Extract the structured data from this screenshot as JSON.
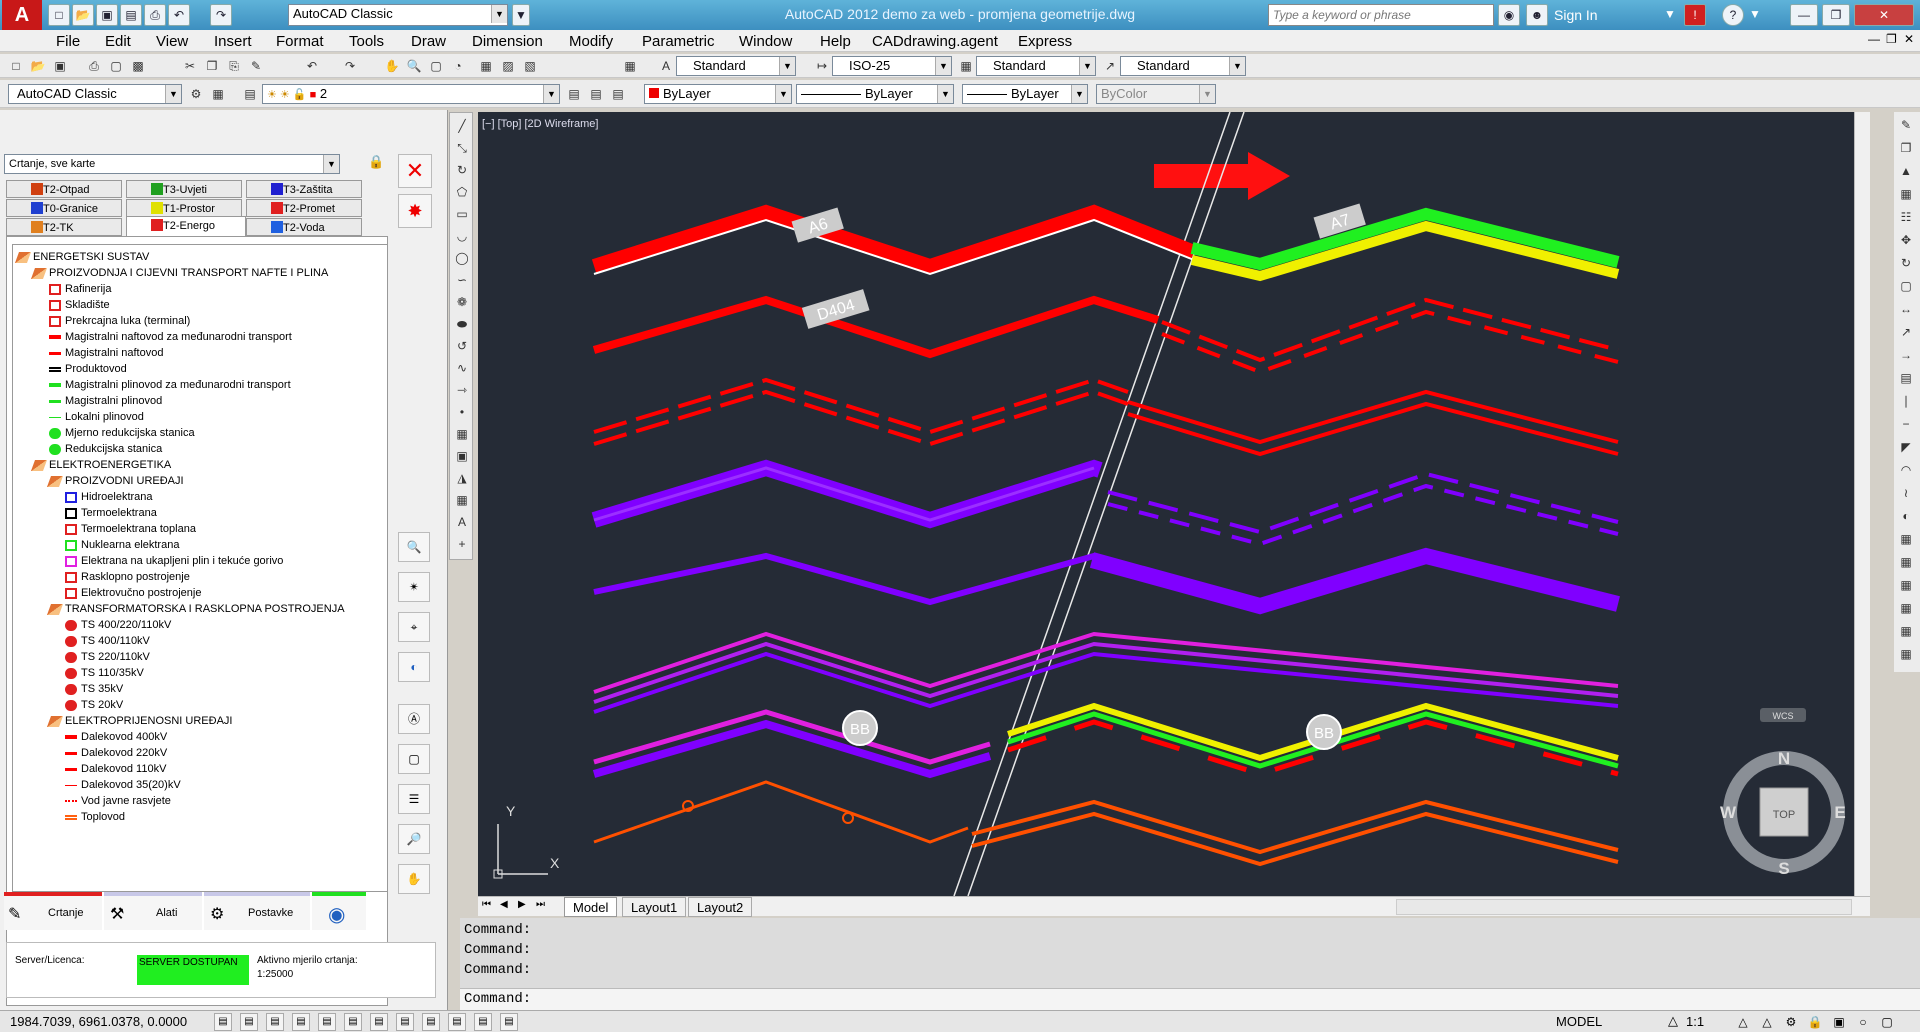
{
  "window": {
    "title": "AutoCAD 2012    demo za web - promjena geometrije.dwg",
    "search_placeholder": "Type a keyword or phrase",
    "sign_in": "Sign In"
  },
  "quick_access": {
    "workspace": "AutoCAD Classic"
  },
  "menu": [
    "File",
    "Edit",
    "View",
    "Insert",
    "Format",
    "Tools",
    "Draw",
    "Dimension",
    "Modify",
    "Parametric",
    "Window",
    "Help",
    "CADdrawing.agent",
    "Express"
  ],
  "toolbar2": {
    "text_style": "Standard",
    "dim_style": "ISO-25",
    "table_style": "Standard",
    "mleader_style": "Standard"
  },
  "toolbar3": {
    "workspace": "AutoCAD Classic",
    "layer": "2",
    "color": "ByLayer",
    "linetype": "ByLayer",
    "lineweight": "ByLayer",
    "plotstyle": "ByColor"
  },
  "panel": {
    "dropdown": "Crtanje, sve karte",
    "tabs": [
      {
        "label": "T2-Otpad",
        "color": "#d04010"
      },
      {
        "label": "T3-Uvjeti",
        "color": "#20a020"
      },
      {
        "label": "T3-Zaštita",
        "color": "#2020d0"
      },
      {
        "label": "T0-Granice",
        "color": "#2040d0"
      },
      {
        "label": "T1-Prostor",
        "color": "#e0e000"
      },
      {
        "label": "T2-Promet",
        "color": "#e02020"
      },
      {
        "label": "T2-TK",
        "color": "#e08020"
      },
      {
        "label": "T2-Energo",
        "color": "#e02020"
      },
      {
        "label": "T2-Voda",
        "color": "#2060e0"
      }
    ],
    "tree": [
      {
        "label": "ENERGETSKI SUSTAV",
        "level": 0,
        "icon": "folder",
        "color": "#e07030"
      },
      {
        "label": "PROIZVODNJA I CIJEVNI TRANSPORT NAFTE I PLINA",
        "level": 1,
        "icon": "folder",
        "color": "#e07030"
      },
      {
        "label": "Rafinerija",
        "level": 2,
        "icon": "box",
        "color": "#e02020"
      },
      {
        "label": "Skladište",
        "level": 2,
        "icon": "box",
        "color": "#e02020"
      },
      {
        "label": "Prekrcajna luka (terminal)",
        "level": 2,
        "icon": "box",
        "color": "#e02020"
      },
      {
        "label": "Magistralni naftovod za međunarodni transport",
        "level": 2,
        "icon": "thick",
        "color": "#ff0000"
      },
      {
        "label": "Magistralni naftovod",
        "level": 2,
        "icon": "line",
        "color": "#ff0000"
      },
      {
        "label": "Produktovod",
        "level": 2,
        "icon": "dbl",
        "color": "#000000"
      },
      {
        "label": "Magistralni plinovod za međunarodni transport",
        "level": 2,
        "icon": "thick",
        "color": "#20e020"
      },
      {
        "label": "Magistralni plinovod",
        "level": 2,
        "icon": "line",
        "color": "#20e020"
      },
      {
        "label": "Lokalni plinovod",
        "level": 2,
        "icon": "thin",
        "color": "#20e020"
      },
      {
        "label": "Mjerno redukcijska stanica",
        "level": 2,
        "icon": "circle",
        "color": "#20e020"
      },
      {
        "label": "Redukcijska stanica",
        "level": 2,
        "icon": "circle",
        "color": "#20e020"
      },
      {
        "label": "ELEKTROENERGETIKA",
        "level": 1,
        "icon": "folder",
        "color": "#e07030"
      },
      {
        "label": "PROIZVODNI UREĐAJI",
        "level": 2,
        "icon": "folder",
        "color": "#e07030"
      },
      {
        "label": "Hidroelektrana",
        "level": 3,
        "icon": "box",
        "color": "#2020e0"
      },
      {
        "label": "Termoelektrana",
        "level": 3,
        "icon": "box",
        "color": "#000000"
      },
      {
        "label": "Termoelektrana toplana",
        "level": 3,
        "icon": "box",
        "color": "#e02020"
      },
      {
        "label": "Nuklearna elektrana",
        "level": 3,
        "icon": "box",
        "color": "#20e020"
      },
      {
        "label": "Elektrana na ukapljeni plin i tekuće gorivo",
        "level": 3,
        "icon": "box",
        "color": "#e020e0"
      },
      {
        "label": "Rasklopno postrojenje",
        "level": 3,
        "icon": "box",
        "color": "#e02020"
      },
      {
        "label": "Elektrovučno postrojenje",
        "level": 3,
        "icon": "box",
        "color": "#e02020"
      },
      {
        "label": "TRANSFORMATORSKA I RASKLOPNA POSTROJENJA",
        "level": 2,
        "icon": "folder",
        "color": "#e07030"
      },
      {
        "label": "TS 400/220/110kV",
        "level": 3,
        "icon": "circle",
        "color": "#e02020"
      },
      {
        "label": "TS 400/110kV",
        "level": 3,
        "icon": "circle",
        "color": "#e02020"
      },
      {
        "label": "TS 220/110kV",
        "level": 3,
        "icon": "circle",
        "color": "#e02020"
      },
      {
        "label": "TS 110/35kV",
        "level": 3,
        "icon": "circle",
        "color": "#e02020"
      },
      {
        "label": "TS 35kV",
        "level": 3,
        "icon": "circle",
        "color": "#e02020"
      },
      {
        "label": "TS 20kV",
        "level": 3,
        "icon": "circle",
        "color": "#e02020"
      },
      {
        "label": "ELEKTROPRIJENOSNI UREĐAJI",
        "level": 2,
        "icon": "folder",
        "color": "#e07030"
      },
      {
        "label": "Dalekovod 400kV",
        "level": 3,
        "icon": "thick",
        "color": "#ff0000"
      },
      {
        "label": "Dalekovod 220kV",
        "level": 3,
        "icon": "line",
        "color": "#ff0000"
      },
      {
        "label": "Dalekovod 110kV",
        "level": 3,
        "icon": "line",
        "color": "#ff0000"
      },
      {
        "label": "Dalekovod 35(20)kV",
        "level": 3,
        "icon": "thin",
        "color": "#ff0000"
      },
      {
        "label": "Vod javne rasvjete",
        "level": 3,
        "icon": "dotline",
        "color": "#ff0000"
      },
      {
        "label": "Toplovod",
        "level": 3,
        "icon": "dbl",
        "color": "#ff6010"
      }
    ],
    "bottom_tabs": [
      {
        "label": "Crtanje",
        "icon": "pencil-icon"
      },
      {
        "label": "Alati",
        "icon": "tools-icon"
      },
      {
        "label": "Postavke",
        "icon": "gear-icon"
      },
      {
        "label": "",
        "icon": "globe-icon"
      }
    ],
    "status": {
      "server_label": "Server/Licenca:",
      "server_value": "SERVER DOSTUPAN",
      "scale_label": "Aktivno mjerilo crtanja:",
      "scale_value": "1:25000"
    }
  },
  "canvas": {
    "viewport_label": "[−] [Top] [2D Wireframe]",
    "labels": [
      "A6",
      "A7",
      "D404",
      "BB",
      "BB"
    ],
    "ucs_y": "Y",
    "ucs_x": "X",
    "viewcube": {
      "n": "N",
      "s": "S",
      "e": "E",
      "w": "W",
      "top": "TOP",
      "wcs": "WCS"
    }
  },
  "layout_tabs": [
    "Model",
    "Layout1",
    "Layout2"
  ],
  "command": {
    "lines": [
      "Command:",
      "Command:",
      "Command:"
    ],
    "prompt": "Command:"
  },
  "statusbar": {
    "coords": "1984.7039, 6961.0378, 0.0000",
    "model": "MODEL",
    "scale": "1:1"
  }
}
